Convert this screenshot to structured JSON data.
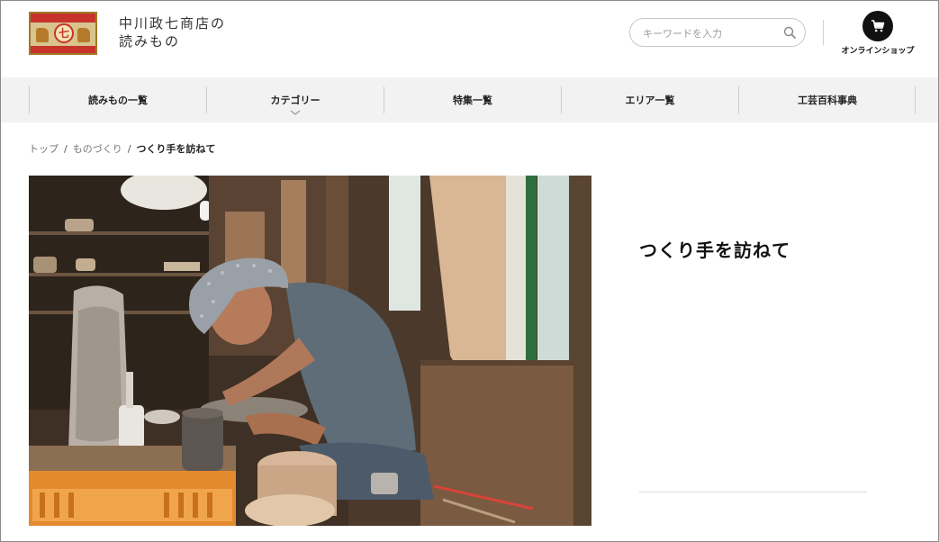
{
  "header": {
    "site_title_line1": "中川政七商店の",
    "site_title_line2": "読みもの",
    "logo_glyph": "七",
    "search": {
      "placeholder": "キーワードを入力"
    },
    "shop_label": "オンラインショップ"
  },
  "nav": {
    "items": [
      {
        "label": "読みもの一覧"
      },
      {
        "label": "カテゴリー"
      },
      {
        "label": "特集一覧"
      },
      {
        "label": "エリア一覧"
      },
      {
        "label": "工芸百科事典"
      }
    ]
  },
  "breadcrumb": {
    "items": [
      "トップ",
      "ものづくり",
      "つくり手を訪ねて"
    ],
    "separator": "/"
  },
  "article": {
    "title": "つくり手を訪ねて"
  },
  "colors": {
    "nav_bg": "#f2f2f2",
    "logo_red": "#c7332a",
    "cart_bg": "#111111"
  }
}
